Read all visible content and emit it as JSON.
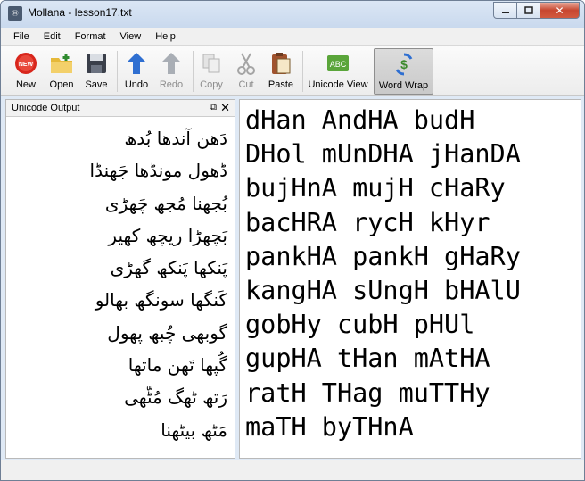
{
  "window": {
    "title": "Mollana - lesson17.txt"
  },
  "menu": [
    "File",
    "Edit",
    "Format",
    "View",
    "Help"
  ],
  "toolbar": {
    "new": "New",
    "open": "Open",
    "save": "Save",
    "undo": "Undo",
    "redo": "Redo",
    "copy": "Copy",
    "cut": "Cut",
    "paste": "Paste",
    "unicode_view": "Unicode View",
    "word_wrap": "Word Wrap"
  },
  "dock": {
    "title": "Unicode Output"
  },
  "urdu_lines": [
    "دَھن آندھا بُدھ",
    "ڈھول مونڈھا جَھنڈا",
    "بُجھنا مُجھ چَھڑی",
    "بَچھڑا ریچھ کھیر",
    "پَنکھا پَنکھ گھڑی",
    "کَنگھا سونگھ بھالو",
    "گوبھی چُبھ پھول",
    "گُپھا تَھن ماتھا",
    "رَتھ ٹھگ مُٹّھی",
    "مَٹھ بیٹھنا"
  ],
  "editor_lines": [
    "dHan AndHA budH",
    "DHol mUnDHA jHanDA",
    "bujHnA mujH cHaRy",
    "bacHRA rycH kHyr",
    "pankHA pankH gHaRy",
    "kangHA sUngH bHAlU",
    "gobHy cubH pHUl",
    "gupHA tHan mAtHA",
    "ratH THag muTTHy",
    "maTH byTHnA"
  ]
}
